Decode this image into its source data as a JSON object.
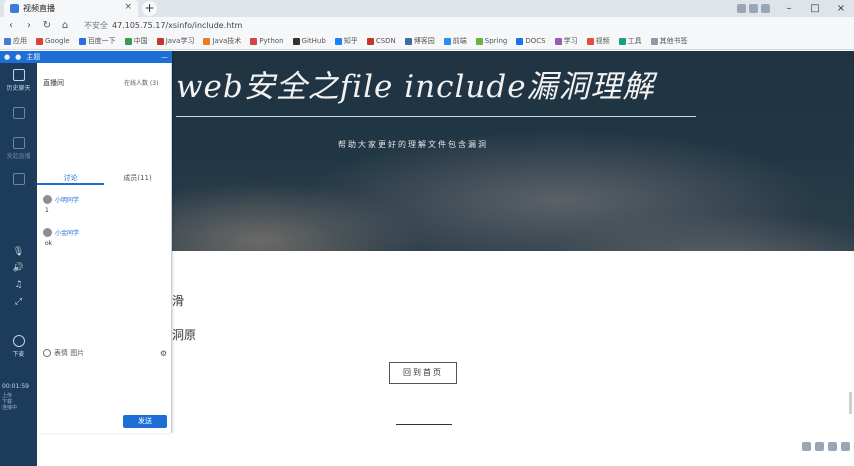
{
  "browser": {
    "tab_title": "视频直播",
    "tab_close": "×",
    "new_tab": "+",
    "security_label": "不安全",
    "url": "47.105.75.17/xsinfo/include.htm",
    "window_controls": {
      "minimize": "–",
      "maximize": "□",
      "close": "×"
    },
    "nav": {
      "back": "‹",
      "forward": "›",
      "reload": "↻",
      "home": "⌂"
    }
  },
  "bookmarks": [
    {
      "label": "应用",
      "color": "#4a7bd3"
    },
    {
      "label": "Google",
      "color": "#db4437"
    },
    {
      "label": "百度一下",
      "color": "#2d6fe0"
    },
    {
      "label": "中国",
      "color": "#3a9a52"
    },
    {
      "label": "Java学习",
      "color": "#c0392b"
    },
    {
      "label": "Java技术",
      "color": "#e67e22"
    },
    {
      "label": "Python",
      "color": "#d04545"
    },
    {
      "label": "GitHub",
      "color": "#333333"
    },
    {
      "label": "知乎",
      "color": "#1e80ff"
    },
    {
      "label": "CSDN",
      "color": "#c0392b"
    },
    {
      "label": "博客园",
      "color": "#3a6ea5"
    },
    {
      "label": "前端",
      "color": "#2d8cf0"
    },
    {
      "label": "Spring",
      "color": "#6db33f"
    },
    {
      "label": "DOCS",
      "color": "#1a73e8"
    },
    {
      "label": "学习",
      "color": "#9b59b6"
    },
    {
      "label": "视频",
      "color": "#e74c3c"
    },
    {
      "label": "工具",
      "color": "#16a085"
    },
    {
      "label": "其他书签",
      "color": "#8e9aa8"
    }
  ],
  "hero": {
    "title": "web安全之file include漏洞理解",
    "subtitle": "帮助大家更好的理解文件包含漏洞"
  },
  "content": {
    "text1": "滑",
    "text2": "洞原",
    "home_button": "回到首页"
  },
  "rail": {
    "items": [
      {
        "label": "历史聊天",
        "dim": false
      },
      {
        "label": "",
        "dim": true
      },
      {
        "label": "发起直播",
        "dim": true
      },
      {
        "label": "",
        "dim": true
      }
    ],
    "mic": "🎙",
    "speaker": "🔊",
    "music": "♫",
    "expand": "⤢",
    "exit_label": "下麦",
    "clock": "00:01:59",
    "info_lines": [
      "上传",
      "下载",
      "连接中"
    ]
  },
  "panel": {
    "header_items": [
      "●",
      "●",
      "主题",
      "—"
    ],
    "room_name": "直播间",
    "online": "在线人数 (3)",
    "tabs": [
      "讨论",
      "成员(11)"
    ],
    "messages": [
      {
        "user": "小明同学",
        "text": "1"
      },
      {
        "user": "小金同学",
        "text": "ok"
      }
    ],
    "footer_label": "表情 图片",
    "gear": "⚙",
    "send_label": "发送"
  }
}
